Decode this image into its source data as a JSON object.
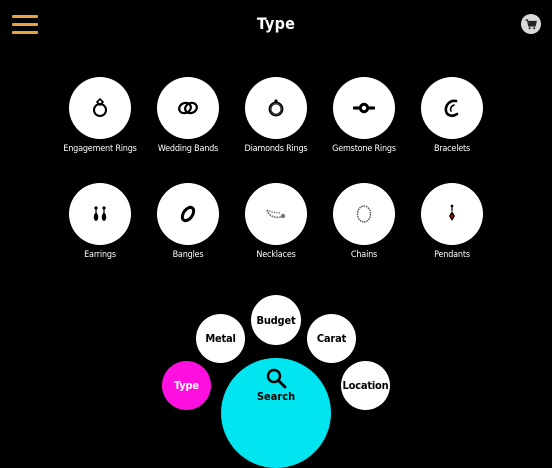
{
  "header": {
    "title": "Type",
    "menu_icon": "hamburger-icon",
    "cart_icon": "cart-icon",
    "menu_color": "#E8A33C"
  },
  "categories": [
    {
      "label": "Engagement Rings",
      "icon": "engagement-ring-icon"
    },
    {
      "label": "Wedding Bands",
      "icon": "wedding-bands-icon"
    },
    {
      "label": "Diamonds Rings",
      "icon": "diamond-ring-icon"
    },
    {
      "label": "Gemstone Rings",
      "icon": "gemstone-ring-icon"
    },
    {
      "label": "Bracelets",
      "icon": "bracelet-icon"
    },
    {
      "label": "Earrings",
      "icon": "earrings-icon"
    },
    {
      "label": "Bangles",
      "icon": "bangle-icon"
    },
    {
      "label": "Necklaces",
      "icon": "necklace-icon"
    },
    {
      "label": "Chains",
      "icon": "chain-icon"
    },
    {
      "label": "Pendants",
      "icon": "pendant-icon"
    }
  ],
  "filters": {
    "type": {
      "label": "Type",
      "active": true,
      "color": "#FF10E0"
    },
    "metal": {
      "label": "Metal"
    },
    "budget": {
      "label": "Budget"
    },
    "carat": {
      "label": "Carat"
    },
    "location": {
      "label": "Location"
    },
    "search": {
      "label": "Search",
      "icon": "search-icon",
      "color": "#00E5F0"
    }
  }
}
